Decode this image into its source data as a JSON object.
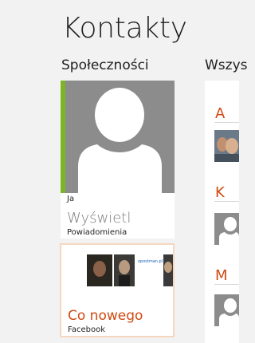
{
  "app": {
    "title": "Kontakty"
  },
  "social": {
    "section_title": "Społeczności",
    "me_tile": {
      "name": "Ja",
      "action": "Wyświetl",
      "subtitle": "Powiadomienia"
    },
    "whats_new_tile": {
      "title": "Co nowego",
      "subtitle": "Facebook",
      "strip_text": "opostman.pl"
    }
  },
  "all_contacts": {
    "section_title": "Wszys",
    "groups": [
      {
        "letter": "A"
      },
      {
        "letter": "K"
      },
      {
        "letter": "M"
      }
    ]
  },
  "colors": {
    "accent_green": "#7db327",
    "accent_orange": "#d04a12",
    "placeholder_gray": "#8c8c8c"
  }
}
